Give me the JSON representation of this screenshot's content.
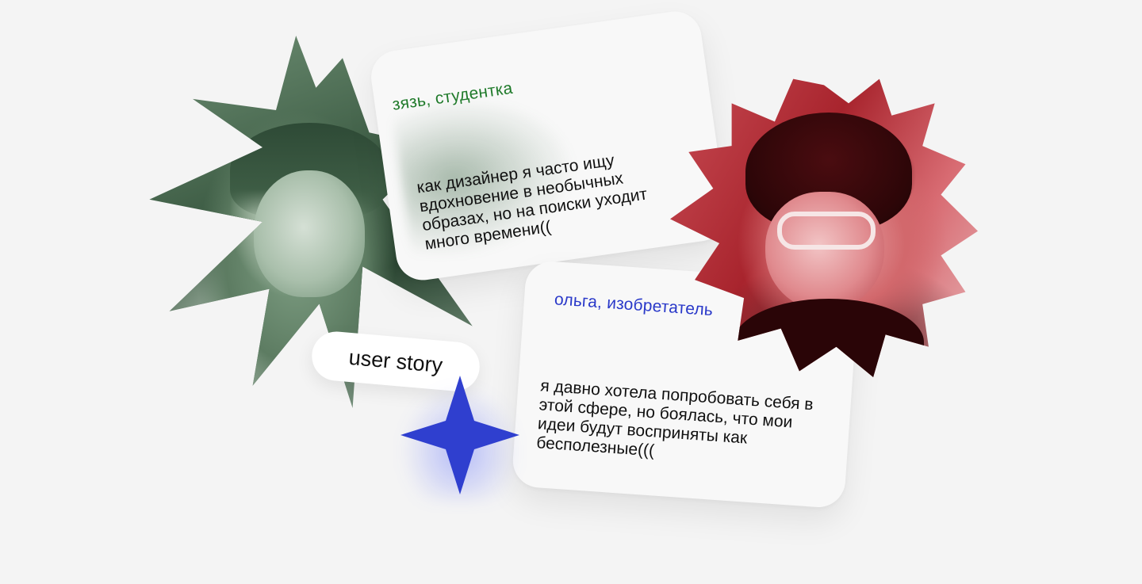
{
  "colors": {
    "background": "#f4f4f4",
    "card": "#f8f8f8",
    "green_accent": "#1f7a2a",
    "blue_accent": "#2a39c9",
    "star_blue": "#2f3fcf"
  },
  "stories": [
    {
      "name": "зязь, студентка",
      "quote": "как дизайнер я часто ищу вдохновение в необычных образах, но на поиски уходит много времени((",
      "photo": "green-tinted-portrait"
    },
    {
      "name": "ольга, изобретатель",
      "quote": "я давно хотела попробовать себя в этой сфере, но боялась, что мои идеи будут восприняты как бесполезные(((",
      "photo": "red-tinted-portrait"
    }
  ],
  "badge": {
    "label": "user story"
  },
  "icons": {
    "sparkle": "four-point-star-icon"
  }
}
